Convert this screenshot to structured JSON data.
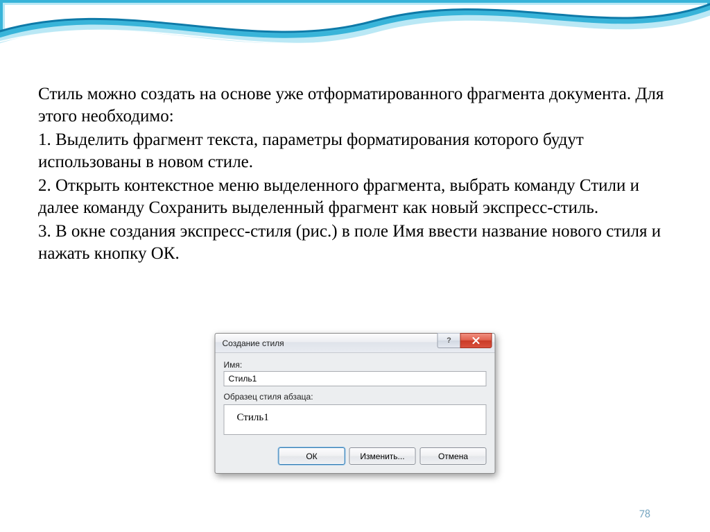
{
  "body": {
    "p1": "Стиль можно создать на основе уже отформатированного фрагмента документа. Для этого необходимо:",
    "p2": "1. Выделить фрагмент текста, параметры форматирования которого будут использованы в новом стиле.",
    "p3": "2. Открыть контекстное меню выделенного фрагмента, выбрать команду Стили и далее команду Сохранить выделенный фрагмент как новый экспресс-стиль.",
    "p4": "3. В окне создания экспресс-стиля (рис.) в поле Имя ввести название нового стиля и нажать кнопку ОК."
  },
  "dialog": {
    "title": "Создание стиля",
    "help_symbol": "?",
    "name_label": "Имя:",
    "name_value": "Стиль1",
    "sample_label": "Образец стиля абзаца:",
    "sample_text": "Стиль1",
    "buttons": {
      "ok": "ОК",
      "modify": "Изменить...",
      "cancel": "Отмена"
    }
  },
  "page_number": "78",
  "colors": {
    "wave_dark": "#0e7aa8",
    "wave_mid": "#2aaed6",
    "wave_light": "#a9e2f3",
    "page_num": "#7aa8c2"
  }
}
